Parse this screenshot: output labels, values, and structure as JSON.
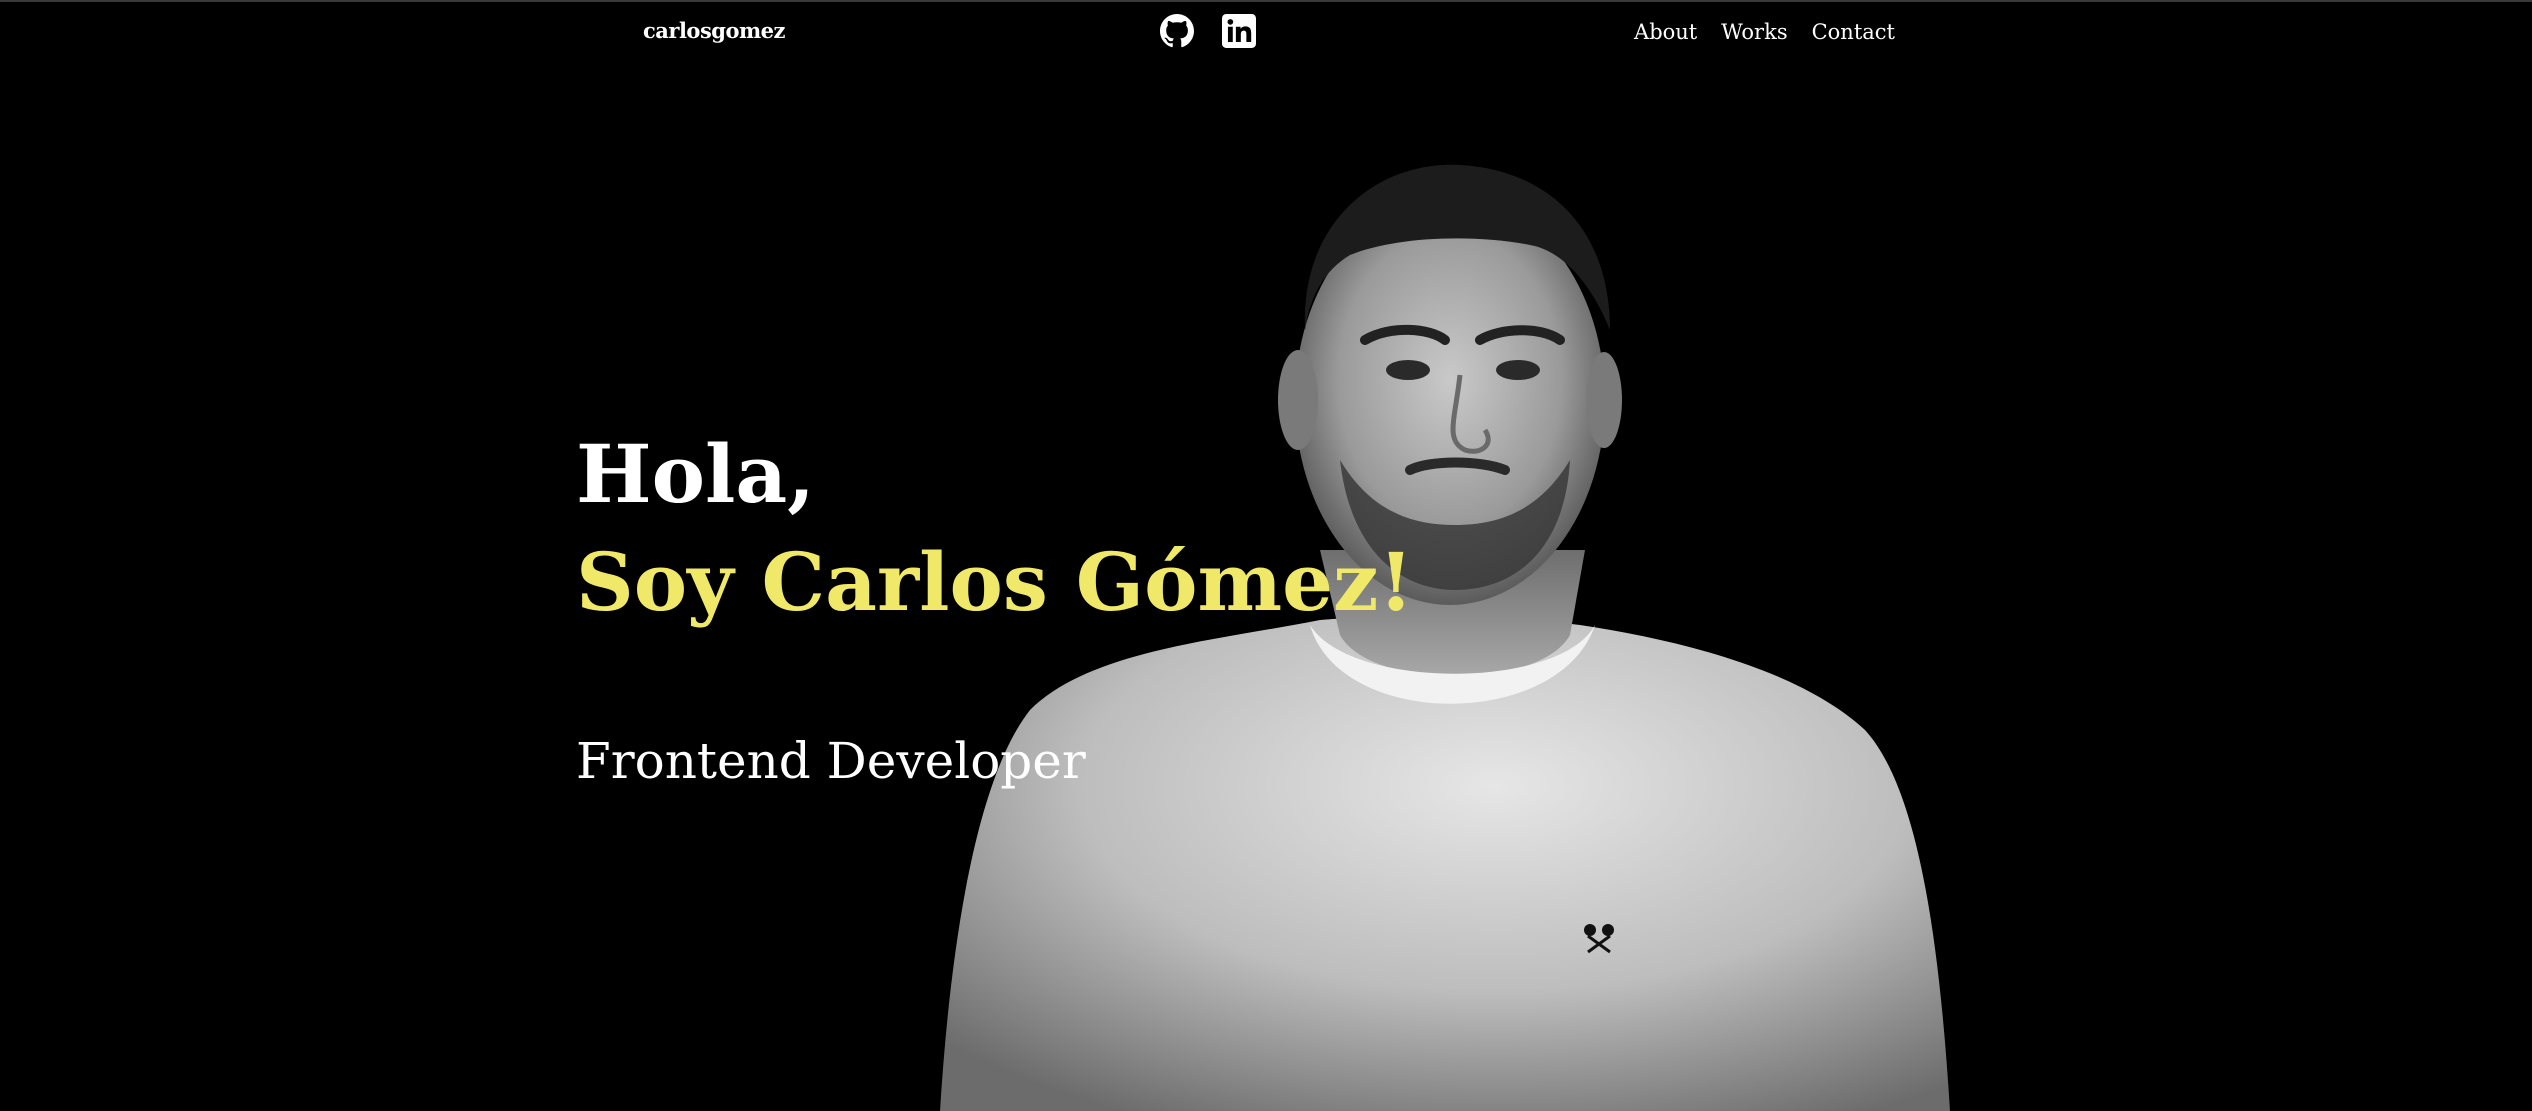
{
  "header": {
    "brand": "carlosgomez",
    "social": [
      {
        "icon": "github-icon"
      },
      {
        "icon": "linkedin-icon"
      }
    ],
    "nav": [
      {
        "label": "About"
      },
      {
        "label": "Works"
      },
      {
        "label": "Contact"
      }
    ]
  },
  "hero": {
    "greeting": "Hola,",
    "name": "Soy Carlos Gómez!",
    "role": "Frontend Developer"
  },
  "colors": {
    "background": "#000000",
    "accent": "#f0e868",
    "text": "#ffffff"
  }
}
